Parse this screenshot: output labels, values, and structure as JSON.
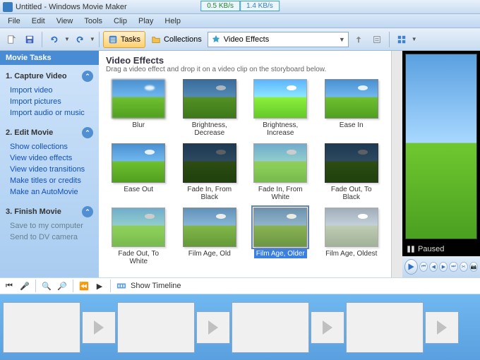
{
  "title": "Untitled - Windows Movie Maker",
  "speed": {
    "down": "0.5 KB/s",
    "up": "1.4 KB/s"
  },
  "menu": [
    "File",
    "Edit",
    "View",
    "Tools",
    "Clip",
    "Play",
    "Help"
  ],
  "toolbar": {
    "tasks_label": "Tasks",
    "collections_label": "Collections",
    "dropdown_value": "Video Effects"
  },
  "sidebar": {
    "header": "Movie Tasks",
    "sections": [
      {
        "title": "1. Capture Video",
        "items": [
          "Import video",
          "Import pictures",
          "Import audio or music"
        ]
      },
      {
        "title": "2. Edit Movie",
        "items": [
          "Show collections",
          "View video effects",
          "View video transitions",
          "Make titles or credits",
          "Make an AutoMovie"
        ]
      },
      {
        "title": "3. Finish Movie",
        "items": [
          "Save to my computer",
          "Send to DV camera"
        ]
      }
    ]
  },
  "effects": {
    "title": "Video Effects",
    "subtitle": "Drag a video effect and drop it on a video clip on the storyboard below.",
    "items": [
      {
        "label": "Blur",
        "cls": "blur"
      },
      {
        "label": "Brightness, Decrease",
        "cls": "dark"
      },
      {
        "label": "Brightness, Increase",
        "cls": "bright"
      },
      {
        "label": "Ease In",
        "cls": ""
      },
      {
        "label": "Ease Out",
        "cls": ""
      },
      {
        "label": "Fade In, From Black",
        "cls": "fadeblack"
      },
      {
        "label": "Fade In, From White",
        "cls": "fadewhite"
      },
      {
        "label": "Fade Out, To Black",
        "cls": "fadeblack"
      },
      {
        "label": "Fade Out, To White",
        "cls": "fadewhite"
      },
      {
        "label": "Film Age, Old",
        "cls": "old"
      },
      {
        "label": "Film Age, Older",
        "cls": "older"
      },
      {
        "label": "Film Age, Oldest",
        "cls": "oldest"
      }
    ],
    "selected_index": 10
  },
  "preview": {
    "status": "Paused"
  },
  "timeline": {
    "show_label": "Show Timeline"
  }
}
